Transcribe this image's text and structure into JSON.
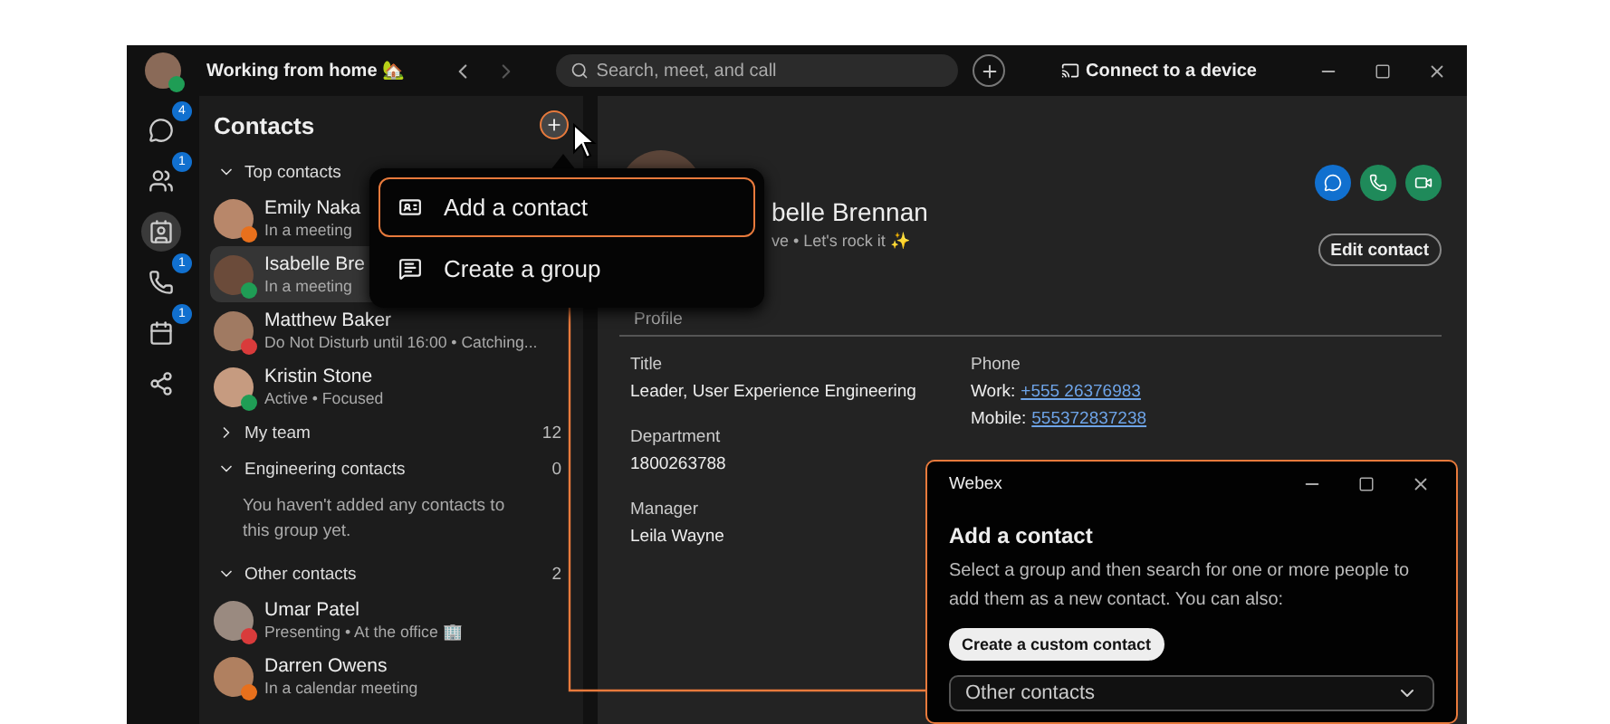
{
  "titlebar": {
    "status": "Working from home 🏡",
    "search_placeholder": "Search, meet, and call",
    "connect": "Connect to a device"
  },
  "rail": [
    {
      "kind": "chat",
      "badge": "4",
      "selected": false
    },
    {
      "kind": "teams",
      "badge": "1",
      "selected": false
    },
    {
      "kind": "contacts",
      "selected": true
    },
    {
      "kind": "calls",
      "badge": "1",
      "selected": false
    },
    {
      "kind": "calendar",
      "badge": "1",
      "selected": false
    },
    {
      "kind": "apps",
      "selected": false
    }
  ],
  "contacts": {
    "title": "Contacts",
    "groups": [
      {
        "label": "Top contacts",
        "expanded": true,
        "contacts": [
          {
            "name": "Emily Naka",
            "status": "In a meeting",
            "color": "#e8701c",
            "selected": false
          },
          {
            "name": "Isabelle Bre",
            "status": "In a meeting",
            "color": "#1f9d55",
            "selected": true
          },
          {
            "name": "Matthew Baker",
            "status": "Do Not Disturb until 16:00 • Catching...",
            "color": "#d93b3b",
            "selected": false
          },
          {
            "name": "Kristin Stone",
            "status": "Active • Focused",
            "color": "#1f9d55",
            "selected": false
          }
        ]
      },
      {
        "label": "My team",
        "expanded": false,
        "count": "12"
      },
      {
        "label": "Engineering contacts",
        "expanded": true,
        "count": "0",
        "empty_text": "You haven't added any contacts to this group yet."
      },
      {
        "label": "Other contacts",
        "expanded": true,
        "count": "2",
        "contacts": [
          {
            "name": "Umar Patel",
            "status": "Presenting • At the office 🏢",
            "color": "#d93b3b",
            "selected": false
          },
          {
            "name": "Darren Owens",
            "status": "In a calendar meeting",
            "color": "#e8701c",
            "selected": false
          }
        ]
      }
    ]
  },
  "menu": [
    {
      "kind": "contact",
      "label": "Add a contact",
      "selected": true
    },
    {
      "kind": "group",
      "label": "Create a group",
      "selected": false
    }
  ],
  "profile": {
    "name": "belle Brennan",
    "status": "ve • Let's rock it ✨",
    "edit": "Edit contact",
    "tab": "Profile",
    "fields": [
      {
        "label": "Title",
        "value": "Leader, User Experience Engineering"
      },
      {
        "label": "Department",
        "value": "1800263788"
      },
      {
        "label": "Manager",
        "value": "Leila Wayne"
      }
    ],
    "phone": {
      "label": "Phone",
      "entries": [
        {
          "label": "Work:",
          "value": "+555 26376983"
        },
        {
          "label": "Mobile:",
          "value": "555372837238"
        }
      ]
    }
  },
  "dialog": {
    "title": "Webex",
    "heading": "Add a contact",
    "text": "Select a group and then search for one or more people to add them as a new contact. You can also:",
    "button": "Create a custom contact",
    "select_value": "Other contacts"
  }
}
